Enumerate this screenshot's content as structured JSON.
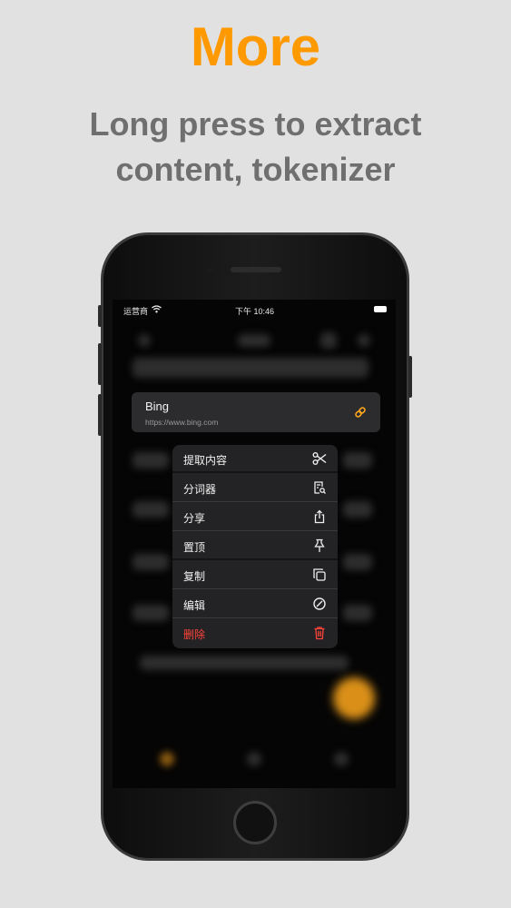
{
  "promo": {
    "headline": "More",
    "subline": "Long press to extract content, tokenizer"
  },
  "status_bar": {
    "carrier": "运营商",
    "time": "下午 10:46"
  },
  "link_card": {
    "title": "Bing",
    "url": "https://www.bing.com"
  },
  "context_menu": {
    "items": [
      {
        "label": "提取内容",
        "icon": "scissors-icon"
      },
      {
        "label": "分词器",
        "icon": "document-search-icon"
      },
      {
        "label": "分享",
        "icon": "share-icon"
      },
      {
        "label": "置顶",
        "icon": "pin-icon"
      },
      {
        "label": "复制",
        "icon": "copy-icon"
      },
      {
        "label": "编辑",
        "icon": "edit-circle-icon"
      },
      {
        "label": "删除",
        "icon": "trash-icon",
        "color": "#ff453a"
      }
    ]
  },
  "colors": {
    "accent": "#ff9900",
    "destructive": "#ff453a",
    "background": "#e1e1e1"
  }
}
